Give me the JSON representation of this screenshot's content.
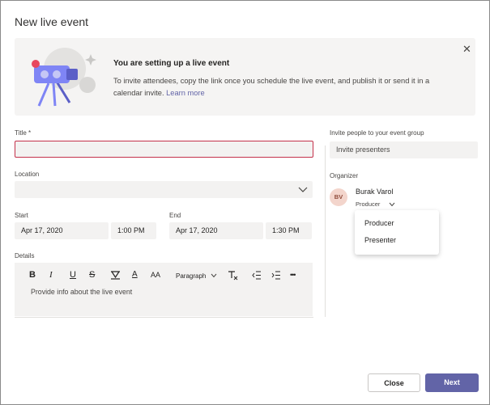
{
  "dialog": {
    "title": "New live event"
  },
  "banner": {
    "heading": "You are setting up a live event",
    "text": "To invite attendees, copy the link once you schedule the live event, and publish it or send it in a calendar invite.",
    "link": "Learn more",
    "close_icon": "close-icon",
    "illustration": "camera-illustration"
  },
  "form": {
    "title_label": "Title *",
    "title_value": "",
    "location_label": "Location",
    "location_value": "",
    "start_label": "Start",
    "start_date": "Apr 17, 2020",
    "start_time": "1:00 PM",
    "end_label": "End",
    "end_date": "Apr 17, 2020",
    "end_time": "1:30 PM",
    "details_label": "Details",
    "details_placeholder": "Provide info about the live event",
    "toolbar": {
      "bold": "B",
      "italic": "I",
      "underline": "U",
      "strikethrough": "S",
      "highlight": "highlight-icon",
      "font_color": "A",
      "font_size": "AA",
      "paragraph": "Paragraph",
      "clear_formatting": "clear-formatting-icon",
      "decrease_indent": "decrease-indent-icon",
      "increase_indent": "increase-indent-icon",
      "more": "•••"
    }
  },
  "invite": {
    "label": "Invite people to your event group",
    "placeholder": "Invite presenters"
  },
  "organizer": {
    "label": "Organizer",
    "initials": "BV",
    "name": "Burak Varol",
    "role": "Producer",
    "role_options": [
      "Producer",
      "Presenter"
    ]
  },
  "footer": {
    "close": "Close",
    "next": "Next"
  },
  "colors": {
    "accent": "#6264a7",
    "error": "#c4314b",
    "avatar_bg": "#f3d5cc"
  }
}
